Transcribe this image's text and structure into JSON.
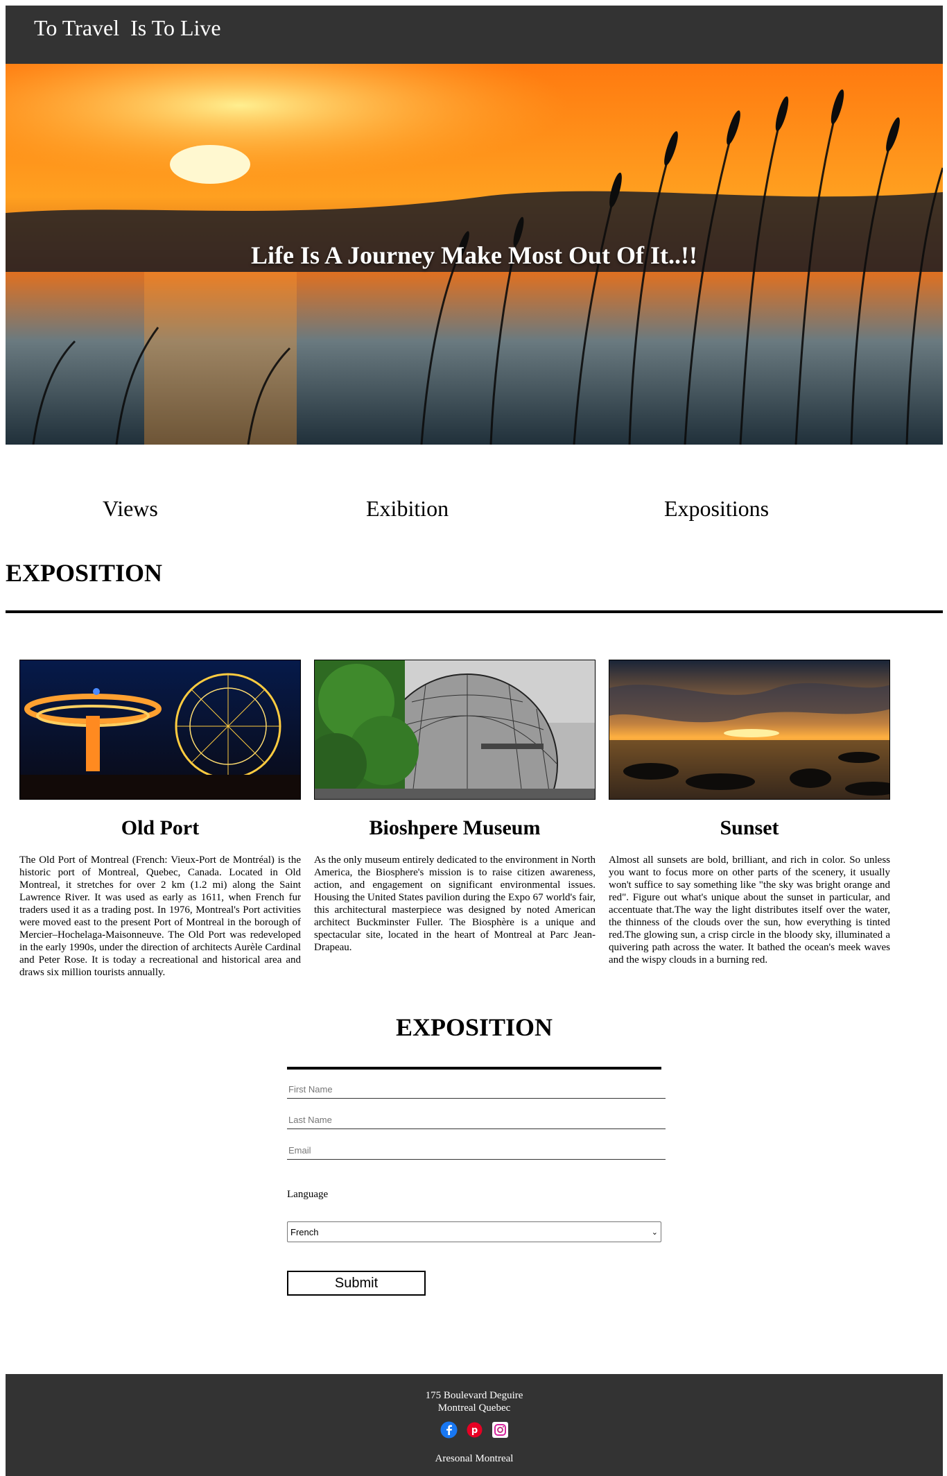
{
  "header": {
    "brand": "To Travel  Is To Live"
  },
  "hero": {
    "tagline": "Life Is A Journey Make Most Out Of It..!!"
  },
  "nav": {
    "items": [
      {
        "label": "Views"
      },
      {
        "label": "Exibition"
      },
      {
        "label": "Expositions"
      }
    ]
  },
  "exposition": {
    "title": "EXPOSITION",
    "cards": [
      {
        "title": "Old Port",
        "text": "The Old Port of Montreal (French: Vieux-Port de Montréal) is the historic port of Montreal, Quebec, Canada. Located in Old Montreal, it stretches for over 2 km (1.2 mi) along the Saint Lawrence River. It was used as early as 1611, when French fur traders used it as a trading post. In 1976, Montreal's Port activities were moved east to the present Port of Montreal in the borough of Mercier–Hochelaga-Maisonneuve. The Old Port was redeveloped in the early 1990s, under the direction of architects Aurèle Cardinal and Peter Rose. It is today a recreational and historical area and draws six million tourists annually."
      },
      {
        "title": "Bioshpere Museum",
        "text": "As the only museum entirely dedicated to the environment in North America, the Biosphere's mission is to raise citizen awareness, action, and engagement on significant environmental issues. Housing the United States pavilion during the Expo 67 world's fair, this architectural masterpiece was designed by noted American architect Buckminster Fuller. The Biosphère is a unique and spectacular site, located in the heart of Montreal at Parc Jean-Drapeau."
      },
      {
        "title": "Sunset",
        "text": "Almost all sunsets are bold, brilliant, and rich in color. So unless you want to focus more on other parts of the scenery, it usually won't suffice to say something like \"the sky was bright orange and red\". Figure out what's unique about the sunset in particular, and accentuate that.The way the light distributes itself over the water, the thinness of the clouds over the sun, how everything is tinted red.The glowing sun, a crisp circle in the bloody sky, illuminated a quivering path across the water. It bathed the ocean's meek waves and the wispy clouds in a burning red."
      }
    ]
  },
  "form": {
    "title": "EXPOSITION",
    "first_name_placeholder": "First Name",
    "last_name_placeholder": "Last Name",
    "email_placeholder": "Email",
    "language_label": "Language",
    "language_selected": "French",
    "submit_label": "Submit"
  },
  "footer": {
    "address_line1": "175 Boulevard Deguire",
    "address_line2": "Montreal Quebec",
    "social_icons": [
      "facebook-icon",
      "pinterest-icon",
      "instagram-icon"
    ],
    "copyright": "Aresonal Montreal"
  },
  "colors": {
    "header_bg": "#333333",
    "footer_bg": "#333333",
    "facebook": "#1877f2",
    "pinterest": "#e60023"
  }
}
